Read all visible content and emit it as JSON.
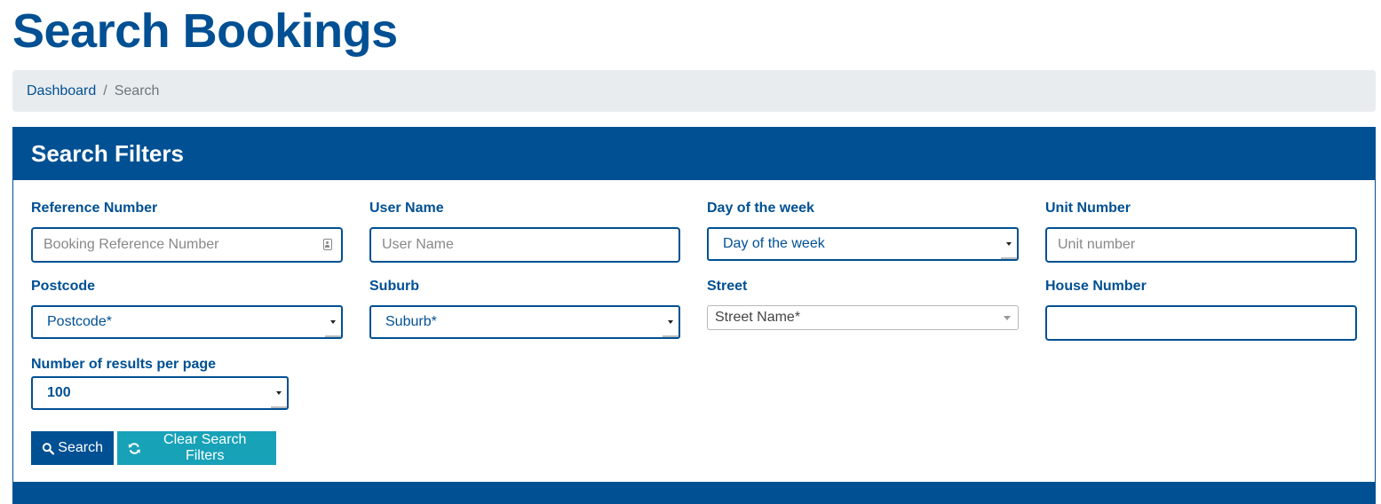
{
  "page": {
    "title": "Search Bookings"
  },
  "breadcrumb": {
    "home": "Dashboard",
    "separator": "/",
    "current": "Search"
  },
  "panel": {
    "title": "Search Filters"
  },
  "fields": {
    "reference_number": {
      "label": "Reference Number",
      "placeholder": "Booking Reference Number"
    },
    "user_name": {
      "label": "User Name",
      "placeholder": "User Name"
    },
    "day_of_week": {
      "label": "Day of the week",
      "value": "Day of the week"
    },
    "unit_number": {
      "label": "Unit Number",
      "placeholder": "Unit number"
    },
    "postcode": {
      "label": "Postcode",
      "value": "Postcode*"
    },
    "suburb": {
      "label": "Suburb",
      "value": "Suburb*"
    },
    "street": {
      "label": "Street",
      "value": "Street Name*"
    },
    "house_number": {
      "label": "House Number",
      "placeholder": ""
    },
    "results_per_page": {
      "label": "Number of results per page",
      "value": "100"
    }
  },
  "buttons": {
    "search": "Search",
    "clear": "Clear Search Filters"
  },
  "icons": {
    "search": "search-icon",
    "refresh": "refresh-icon",
    "contact": "contact-card-icon"
  },
  "colors": {
    "primary": "#005093",
    "info": "#17a2b8",
    "breadcrumb_bg": "#e9ecef"
  }
}
